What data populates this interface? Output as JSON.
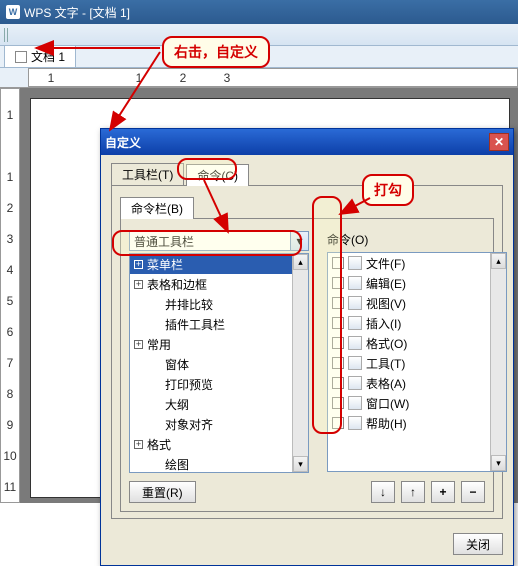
{
  "app": {
    "title": "WPS 文字 - [文档 1]",
    "doc_tab": "文档 1"
  },
  "ruler_h": [
    "1",
    "",
    "1",
    "2",
    "3"
  ],
  "ruler_v": [
    "1",
    "",
    "1",
    "2",
    "3",
    "4",
    "5",
    "6",
    "7",
    "8",
    "9",
    "10",
    "11"
  ],
  "dialog": {
    "title": "自定义",
    "tabs_top": [
      {
        "label": "工具栏(T)",
        "active": false
      },
      {
        "label": "命令(C)",
        "active": true
      }
    ],
    "tabs_second": [
      {
        "label": "命令栏(B)",
        "active": true
      }
    ],
    "left_combo": "普通工具栏",
    "left_items": [
      {
        "exp": "+",
        "text": "菜单栏",
        "indent": 0,
        "sel": true
      },
      {
        "exp": "+",
        "text": "表格和边框",
        "indent": 0
      },
      {
        "exp": "",
        "text": "并排比较",
        "indent": 1
      },
      {
        "exp": "",
        "text": "插件工具栏",
        "indent": 1
      },
      {
        "exp": "+",
        "text": "常用",
        "indent": 0
      },
      {
        "exp": "",
        "text": "窗体",
        "indent": 1
      },
      {
        "exp": "",
        "text": "打印预览",
        "indent": 1
      },
      {
        "exp": "",
        "text": "大纲",
        "indent": 1
      },
      {
        "exp": "",
        "text": "对象对齐",
        "indent": 1
      },
      {
        "exp": "+",
        "text": "格式",
        "indent": 0
      },
      {
        "exp": "",
        "text": "绘图",
        "indent": 1
      }
    ],
    "right_label": "命令(O)",
    "right_items": [
      {
        "text": "文件(F)"
      },
      {
        "text": "编辑(E)"
      },
      {
        "text": "视图(V)"
      },
      {
        "text": "插入(I)"
      },
      {
        "text": "格式(O)"
      },
      {
        "text": "工具(T)"
      },
      {
        "text": "表格(A)"
      },
      {
        "text": "窗口(W)"
      },
      {
        "text": "帮助(H)"
      }
    ],
    "reset_btn": "重置(R)",
    "close_btn": "关闭",
    "sym": {
      "down": "↓",
      "up": "↑",
      "plus": "+",
      "minus": "−"
    }
  },
  "annotations": {
    "tip_top": "右击，自定义",
    "tip_check": "打勾"
  },
  "colors": {
    "accent": "#2a6ad6",
    "ann": "#d40000"
  }
}
